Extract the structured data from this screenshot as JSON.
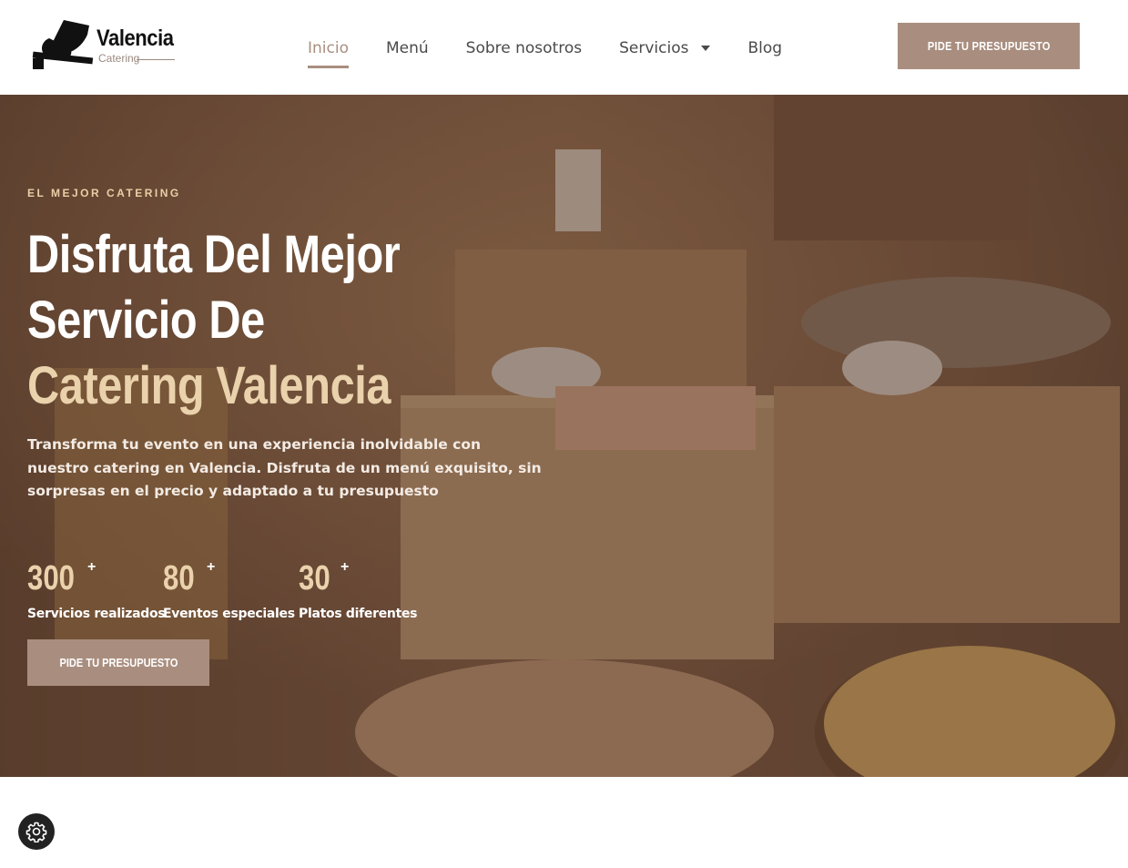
{
  "brand": {
    "name": "Valencia",
    "tagline": "Catering",
    "logo_icon": "bowl-plate-logo-icon"
  },
  "nav": {
    "items": [
      {
        "label": "Inicio",
        "active": true
      },
      {
        "label": "Menú",
        "active": false
      },
      {
        "label": "Sobre nosotros",
        "active": false
      },
      {
        "label": "Servicios",
        "active": false,
        "has_dropdown": true
      },
      {
        "label": "Blog",
        "active": false
      }
    ],
    "cta_label": "PIDE TU PRESUPUESTO"
  },
  "hero": {
    "kicker": "EL MEJOR CATERING",
    "headline_line1": "Disfruta Del Mejor",
    "headline_line2": "Servicio De",
    "headline_accent": "Catering Valencia",
    "lead": "Transforma tu evento en una experiencia inolvidable con nuestro catering en Valencia. Disfruta de un menú exquisito, sin sorpresas en el precio y adaptado a tu presupuesto",
    "stats": [
      {
        "value": "300",
        "suffix": "+",
        "label": "Servicios realizados"
      },
      {
        "value": "80",
        "suffix": "+",
        "label": "Eventos especiales"
      },
      {
        "value": "30",
        "suffix": "+",
        "label": "Platos diferentes"
      }
    ],
    "cta_label": "PIDE TU PRESUPUESTO",
    "background_image": "catering-buffet-table-photo"
  },
  "floating": {
    "settings_icon": "gear-icon"
  },
  "colors": {
    "accent": "#a98e7f",
    "accent_light": "#ead2ac",
    "nav_text": "#4a4a4a"
  }
}
